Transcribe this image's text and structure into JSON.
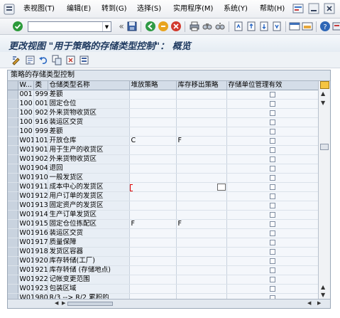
{
  "menu": {
    "items": [
      "表视图(T)",
      "编辑(E)",
      "转到(G)",
      "选择(S)",
      "实用程序(M)",
      "系统(Y)",
      "帮助(H)"
    ]
  },
  "title": "更改视图 \"用于策略的存储类型控制\"： 概览",
  "table": {
    "caption": "策略的存储类型控制",
    "headers": [
      "W...",
      "类",
      "仓储类型名称",
      "堆放策略",
      "库存移出策略",
      "存储单位管理有效"
    ],
    "rows": [
      [
        "001",
        "999",
        "差额",
        "",
        ""
      ],
      [
        "100",
        "001",
        "固定仓位",
        "",
        ""
      ],
      [
        "100",
        "902",
        "外来货物收货区",
        "",
        ""
      ],
      [
        "100",
        "916",
        "装运区交货",
        "",
        ""
      ],
      [
        "100",
        "999",
        "差额",
        "",
        ""
      ],
      [
        "W01",
        "101",
        "开放仓库",
        "C",
        "F"
      ],
      [
        "W01",
        "901",
        "用于生产的收货区",
        "",
        ""
      ],
      [
        "W01",
        "902",
        "外来货物收货区",
        "",
        ""
      ],
      [
        "W01",
        "904",
        "退回",
        "",
        ""
      ],
      [
        "W01",
        "910",
        "一般发货区",
        "",
        ""
      ],
      [
        "W01",
        "911",
        "成本中心的发货区",
        "",
        ""
      ],
      [
        "W01",
        "912",
        "用户订单的发货区",
        "",
        ""
      ],
      [
        "W01",
        "913",
        "固定资产的发货区",
        "",
        ""
      ],
      [
        "W01",
        "914",
        "生产订单发货区",
        "",
        ""
      ],
      [
        "W01",
        "915",
        "固定仓位拣配区",
        "F",
        "F"
      ],
      [
        "W01",
        "916",
        "装运区交货",
        "",
        ""
      ],
      [
        "W01",
        "917",
        "质量保障",
        "",
        ""
      ],
      [
        "W01",
        "918",
        "发货区容器",
        "",
        ""
      ],
      [
        "W01",
        "920",
        "库存转储(工厂)",
        "",
        ""
      ],
      [
        "W01",
        "921",
        "库存转储 (存储地点)",
        "",
        ""
      ],
      [
        "W01",
        "922",
        "记帐变更范围",
        "",
        ""
      ],
      [
        "W01",
        "923",
        "包装区域",
        "",
        ""
      ],
      [
        "W01",
        "980",
        "R/3 --> R/2 累积的",
        "",
        ""
      ]
    ]
  },
  "colors": {
    "title_text": "#1f3a60",
    "table_bg": "#e8eef5",
    "header_bg": "#d4dde8"
  }
}
